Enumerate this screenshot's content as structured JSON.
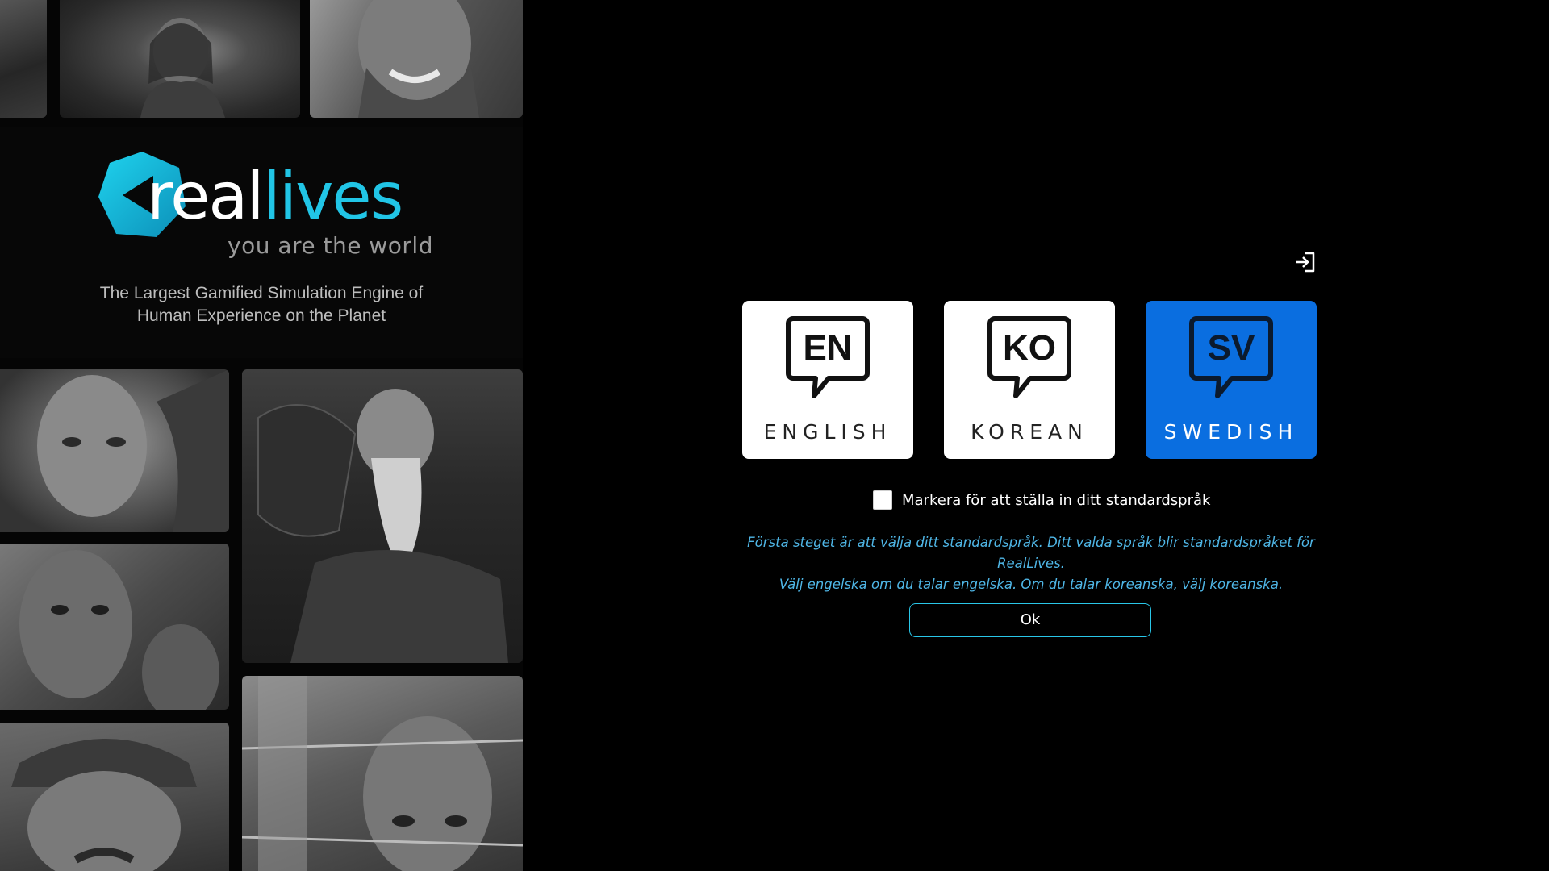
{
  "branding": {
    "word_real": "real",
    "word_lives": "lives",
    "tagline": "you are the world",
    "caption_line1": "The Largest Gamified Simulation Engine of",
    "caption_line2": "Human Experience on the Planet",
    "accent_color": "#21c5e6"
  },
  "header": {
    "signin_icon": "sign-in-icon"
  },
  "languages": [
    {
      "code": "EN",
      "name": "ENGLISH",
      "selected": false
    },
    {
      "code": "KO",
      "name": "KOREAN",
      "selected": false
    },
    {
      "code": "SV",
      "name": "SWEDISH",
      "selected": true
    }
  ],
  "default_language": {
    "checked": false,
    "label": "Markera för att ställa in ditt standardspråk"
  },
  "info": {
    "line1": "Första steget är att välja ditt standardspråk. Ditt valda språk blir standardspråket för RealLives.",
    "line2": "Välj engelska om du talar engelska. Om du talar koreanska, välj koreanska."
  },
  "ok_button": {
    "label": "Ok"
  },
  "colors": {
    "selected_card": "#0a6ee0",
    "info_text": "#4fb6e6",
    "button_border": "#29c6e8"
  }
}
